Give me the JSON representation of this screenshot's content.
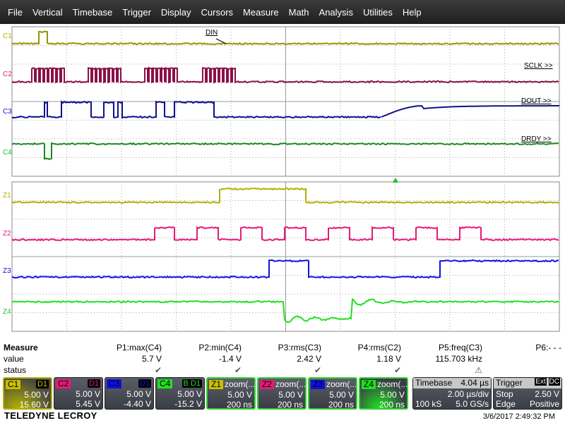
{
  "menu": [
    "File",
    "Vertical",
    "Timebase",
    "Trigger",
    "Display",
    "Cursors",
    "Measure",
    "Math",
    "Analysis",
    "Utilities",
    "Help"
  ],
  "channels": {
    "c1": "C1",
    "c2": "C2",
    "c3": "C3",
    "c4": "C4",
    "z1": "Z1",
    "z2": "Z2",
    "z3": "Z3",
    "z4": "Z4"
  },
  "trace_labels": {
    "din": "DIN",
    "sclk": "SCLK >>",
    "dout": "DOUT >>",
    "drdy": "DRDY >>"
  },
  "colors": {
    "c1": "#b5b000",
    "c2": "#e6197a",
    "c3": "#1010e0",
    "c4": "#20e020"
  },
  "measure": {
    "title": "Measure",
    "value_label": "value",
    "status_label": "status",
    "params": [
      {
        "name": "P1:max(C4)",
        "value": "5.7 V",
        "status": "✔"
      },
      {
        "name": "P2:min(C4)",
        "value": "-1.4 V",
        "status": "✔"
      },
      {
        "name": "P3:rms(C3)",
        "value": "2.42 V",
        "status": "✔"
      },
      {
        "name": "P4:rms(C2)",
        "value": "1.18 V",
        "status": "✔"
      },
      {
        "name": "P5:freq(C3)",
        "value": "115.703 kHz",
        "status": "⚠"
      },
      {
        "name": "P6:- - -",
        "value": "",
        "status": ""
      }
    ]
  },
  "cards": [
    {
      "tag": "C1",
      "badge": "D1",
      "v1": "5.00 V",
      "v2": "15.60 V"
    },
    {
      "tag": "C2",
      "badge": "D1",
      "v1": "5.00 V",
      "v2": "5.45 V"
    },
    {
      "tag": "C3",
      "badge": "D1",
      "v1": "5.00 V",
      "v2": "-4.40 V"
    },
    {
      "tag": "C4",
      "badge": "B D1",
      "v1": "5.00 V",
      "v2": "-15.2 V"
    },
    {
      "tag": "Z1",
      "title": "zoom(...",
      "v1": "5.00 V",
      "v2": "200 ns"
    },
    {
      "tag": "Z2",
      "title": "zoom(...",
      "v1": "5.00 V",
      "v2": "200 ns"
    },
    {
      "tag": "Z3",
      "title": "zoom(...",
      "v1": "5.00 V",
      "v2": "200 ns"
    },
    {
      "tag": "Z4",
      "title": "zoom(...",
      "v1": "5.00 V",
      "v2": "200 ns"
    }
  ],
  "timebase": {
    "label": "Timebase",
    "delay": "4.04 µs",
    "div": "2.00 µs/div",
    "samples": "100 kS",
    "rate": "5.0 GS/s"
  },
  "trigger": {
    "label": "Trigger",
    "badge1": "Ext",
    "badge2": "DC",
    "mode": "Stop",
    "level": "2.50 V",
    "type": "Edge",
    "slope": "Positive"
  },
  "brand": "TELEDYNE LECROY",
  "datetime": "3/6/2017 2:49:32 PM"
}
